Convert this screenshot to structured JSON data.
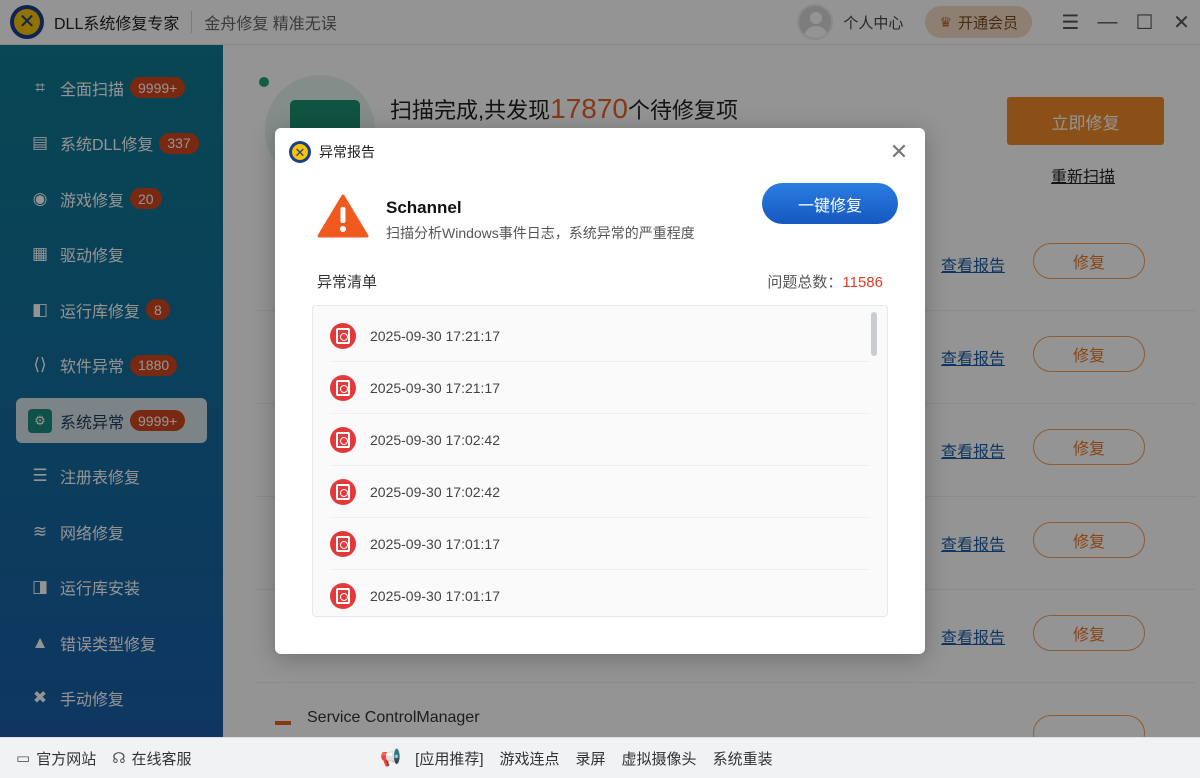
{
  "app": {
    "title": "DLL系统修复专家",
    "slogan": "金舟修复 精准无误",
    "user_center": "个人中心",
    "vip_label": "开通会员"
  },
  "window_controls": {
    "menu": "☰",
    "minimize": "—",
    "maximize": "☐",
    "close": "✕"
  },
  "sidebar": {
    "items": [
      {
        "label": "全面扫描",
        "badge": "9999+",
        "icon": "scan-icon",
        "glyph": "⌗"
      },
      {
        "label": "系统DLL修复",
        "badge": "337",
        "icon": "dll-icon",
        "glyph": "▤"
      },
      {
        "label": "游戏修复",
        "badge": "20",
        "icon": "gamepad-icon",
        "glyph": "◉"
      },
      {
        "label": "驱动修复",
        "badge": "",
        "icon": "driver-icon",
        "glyph": "▦"
      },
      {
        "label": "运行库修复",
        "badge": "8",
        "icon": "runtime-icon",
        "glyph": "◧"
      },
      {
        "label": "软件异常",
        "badge": "1880",
        "icon": "code-icon",
        "glyph": "⟨⟩"
      },
      {
        "label": "系统异常",
        "badge": "9999+",
        "icon": "gear-icon",
        "glyph": "⚙"
      },
      {
        "label": "注册表修复",
        "badge": "",
        "icon": "registry-icon",
        "glyph": "☰"
      },
      {
        "label": "网络修复",
        "badge": "",
        "icon": "wifi-icon",
        "glyph": "≋"
      },
      {
        "label": "运行库安装",
        "badge": "",
        "icon": "install-icon",
        "glyph": "◨"
      },
      {
        "label": "错误类型修复",
        "badge": "",
        "icon": "warning-icon",
        "glyph": "▲"
      },
      {
        "label": "手动修复",
        "badge": "",
        "icon": "wrench-icon",
        "glyph": "✖"
      }
    ],
    "active_index": 6
  },
  "main": {
    "scan_prefix": "扫描完成,共发现",
    "scan_count": "17870",
    "scan_suffix": "个待修复项",
    "repair_now": "立即修复",
    "rescan": "重新扫描",
    "row_report_label": "查看报告",
    "row_fix_label": "修复",
    "last_service_name": "Service ControlManager"
  },
  "dialog": {
    "title": "异常报告",
    "name": "Schannel",
    "description": "扫描分析Windows事件日志，系统异常的严重程度",
    "onekey_fix": "一键修复",
    "list_title": "异常清单",
    "total_label": "问题总数：",
    "total_count": "11586",
    "entries": [
      "2025-09-30 17:21:17",
      "2025-09-30 17:21:17",
      "2025-09-30 17:02:42",
      "2025-09-30 17:02:42",
      "2025-09-30 17:01:17",
      "2025-09-30 17:01:17"
    ]
  },
  "statusbar": {
    "official_site": "官方网站",
    "online_service": "在线客服",
    "promo_links": [
      "[应用推荐]",
      "游戏连点",
      "录屏",
      "虚拟摄像头",
      "系统重装"
    ]
  },
  "colors": {
    "accent_orange": "#f08a28",
    "badge_red": "#d0461e",
    "primary_blue": "#1558bf",
    "danger_red": "#e23a28"
  }
}
